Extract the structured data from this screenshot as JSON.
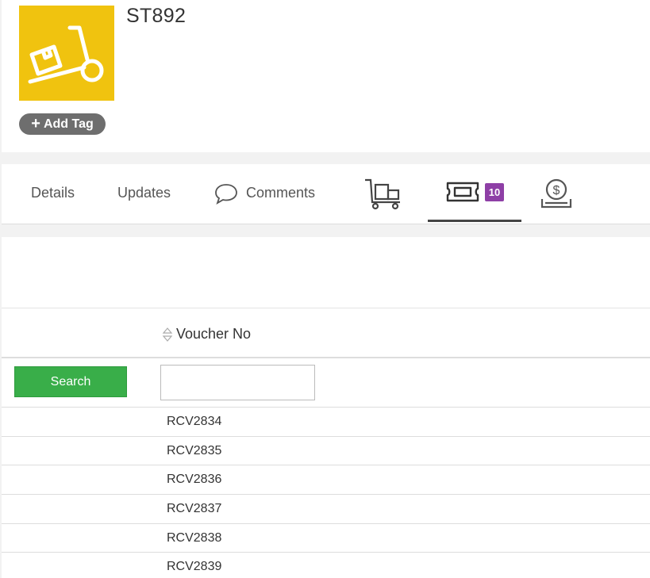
{
  "record": {
    "title": "ST892",
    "add_tag_label": "Add Tag",
    "add_tag_icon": "plus-icon",
    "logo_icon": "hand-truck-box-icon",
    "logo_color": "#f0c30f"
  },
  "tabs": [
    {
      "label": "Details"
    },
    {
      "label": "Updates"
    },
    {
      "label": "Comments",
      "icon": "speech-bubble-icon"
    },
    {
      "icon": "hand-truck-icon"
    },
    {
      "icon": "ticket-icon",
      "badge": "10",
      "active": true
    },
    {
      "icon": "coin-tray-icon"
    }
  ],
  "badge_color": "#8e3fa6",
  "table": {
    "column_header": "Voucher No",
    "search_label": "Search",
    "filter_value": "",
    "rows": [
      "RCV2834",
      "RCV2835",
      "RCV2836",
      "RCV2837",
      "RCV2838",
      "RCV2839"
    ]
  },
  "colors": {
    "search_button": "#39ae49"
  }
}
